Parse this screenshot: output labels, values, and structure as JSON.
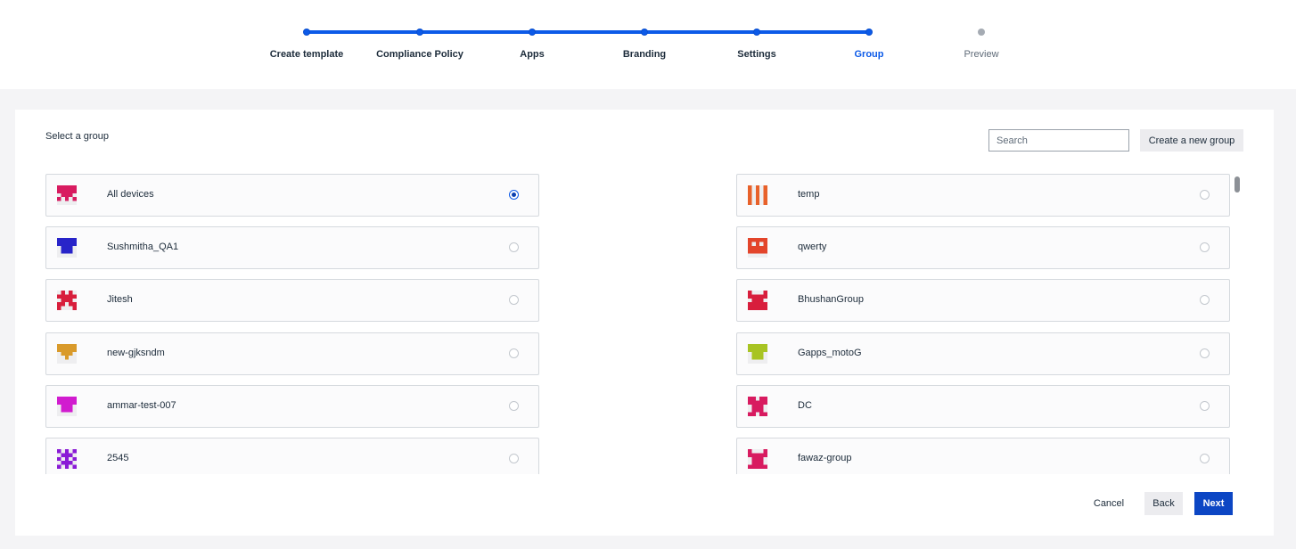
{
  "stepper": {
    "steps": [
      {
        "label": "Create template",
        "state": "done"
      },
      {
        "label": "Compliance Policy",
        "state": "done"
      },
      {
        "label": "Apps",
        "state": "done"
      },
      {
        "label": "Branding",
        "state": "done"
      },
      {
        "label": "Settings",
        "state": "done"
      },
      {
        "label": "Group",
        "state": "active"
      },
      {
        "label": "Preview",
        "state": "todo"
      }
    ],
    "accent_color": "#0c5ae8"
  },
  "group_panel": {
    "title": "Select a group",
    "search_placeholder": "Search",
    "create_button_label": "Create a new group",
    "left_groups": [
      {
        "name": "All devices",
        "avatar_color": "#d81b60",
        "icon": "identicon-avatar",
        "selected": true
      },
      {
        "name": "Sushmitha_QA1",
        "avatar_color": "#2824c9",
        "icon": "identicon-avatar",
        "selected": false
      },
      {
        "name": "Jitesh",
        "avatar_color": "#d81e3c",
        "icon": "identicon-avatar",
        "selected": false
      },
      {
        "name": "new-gjksndm",
        "avatar_color": "#d99a2b",
        "icon": "identicon-avatar",
        "selected": false
      },
      {
        "name": "ammar-test-007",
        "avatar_color": "#d11ccf",
        "icon": "identicon-avatar",
        "selected": false
      },
      {
        "name": "2545",
        "avatar_color": "#8a1bd6",
        "icon": "identicon-avatar",
        "selected": false
      }
    ],
    "right_groups": [
      {
        "name": "temp",
        "avatar_color": "#e8612a",
        "icon": "identicon-avatar",
        "selected": false
      },
      {
        "name": "qwerty",
        "avatar_color": "#e3452b",
        "icon": "identicon-avatar",
        "selected": false
      },
      {
        "name": "BhushanGroup",
        "avatar_color": "#d81e3c",
        "icon": "identicon-avatar",
        "selected": false
      },
      {
        "name": "Gapps_motoG",
        "avatar_color": "#a8c423",
        "icon": "identicon-avatar",
        "selected": false
      },
      {
        "name": "DC",
        "avatar_color": "#d81b60",
        "icon": "identicon-avatar",
        "selected": false
      },
      {
        "name": "fawaz-group",
        "avatar_color": "#d81b60",
        "icon": "identicon-avatar",
        "selected": false
      }
    ]
  },
  "footer": {
    "cancel_label": "Cancel",
    "back_label": "Back",
    "next_label": "Next",
    "next_color": "#0c46c4"
  }
}
